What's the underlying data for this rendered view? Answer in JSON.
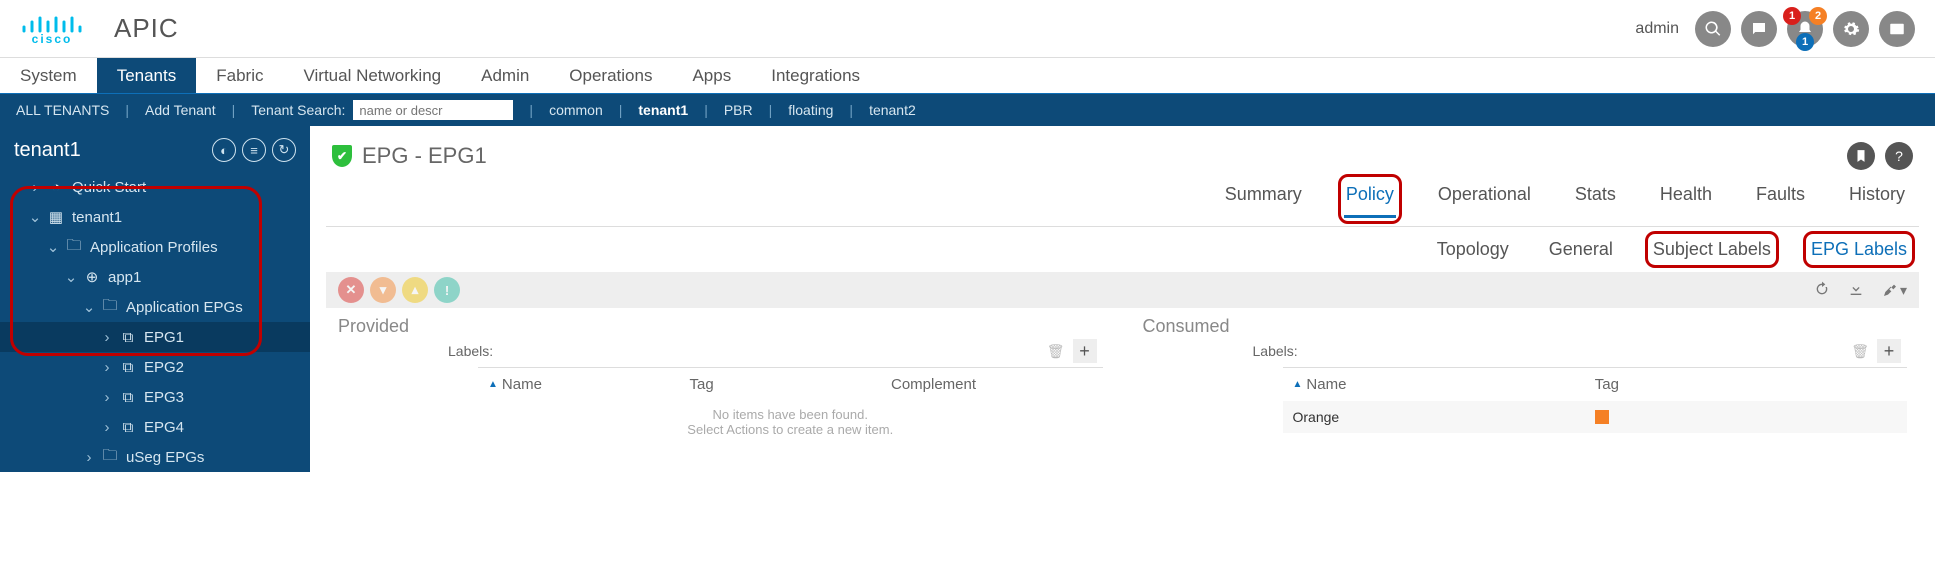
{
  "header": {
    "brand": "cisco",
    "app": "APIC",
    "user": "admin",
    "notif_badges": {
      "crit": "1",
      "warn": "2",
      "info": "1"
    }
  },
  "nav": [
    "System",
    "Tenants",
    "Fabric",
    "Virtual Networking",
    "Admin",
    "Operations",
    "Apps",
    "Integrations"
  ],
  "nav_active": "Tenants",
  "subnav": {
    "all": "ALL TENANTS",
    "add": "Add Tenant",
    "search_label": "Tenant Search:",
    "search_ph": "name or descr",
    "links": [
      "common",
      "tenant1",
      "PBR",
      "floating",
      "tenant2"
    ],
    "active": "tenant1"
  },
  "sidebar": {
    "title": "tenant1",
    "tree": [
      {
        "l": "Quick Start",
        "d": 0,
        "chev": ">",
        "ico": "compass"
      },
      {
        "l": "tenant1",
        "d": 0,
        "chev": "v",
        "ico": "grid"
      },
      {
        "l": "Application Profiles",
        "d": 1,
        "chev": "v",
        "ico": "folder"
      },
      {
        "l": "app1",
        "d": 2,
        "chev": "v",
        "ico": "globe"
      },
      {
        "l": "Application EPGs",
        "d": 3,
        "chev": "v",
        "ico": "folder"
      },
      {
        "l": "EPG1",
        "d": 4,
        "chev": ">",
        "ico": "epg",
        "sel": true
      },
      {
        "l": "EPG2",
        "d": 4,
        "chev": ">",
        "ico": "epg"
      },
      {
        "l": "EPG3",
        "d": 4,
        "chev": ">",
        "ico": "epg"
      },
      {
        "l": "EPG4",
        "d": 4,
        "chev": ">",
        "ico": "epg"
      },
      {
        "l": "uSeg EPGs",
        "d": 3,
        "chev": ">",
        "ico": "folder"
      }
    ]
  },
  "page": {
    "title": "EPG - EPG1",
    "tabs": [
      "Summary",
      "Policy",
      "Operational",
      "Stats",
      "Health",
      "Faults",
      "History"
    ],
    "tab_active": "Policy",
    "subtabs": [
      "Topology",
      "General",
      "Subject Labels",
      "EPG Labels"
    ],
    "subtab_active": "EPG Labels"
  },
  "panels": {
    "provided": {
      "heading": "Provided",
      "labels_label": "Labels:",
      "cols": [
        "Name",
        "Tag",
        "Complement"
      ],
      "empty1": "No items have been found.",
      "empty2": "Select Actions to create a new item."
    },
    "consumed": {
      "heading": "Consumed",
      "labels_label": "Labels:",
      "cols": [
        "Name",
        "Tag"
      ],
      "rows": [
        {
          "name": "Orange",
          "tag": "#f58025"
        }
      ]
    }
  }
}
